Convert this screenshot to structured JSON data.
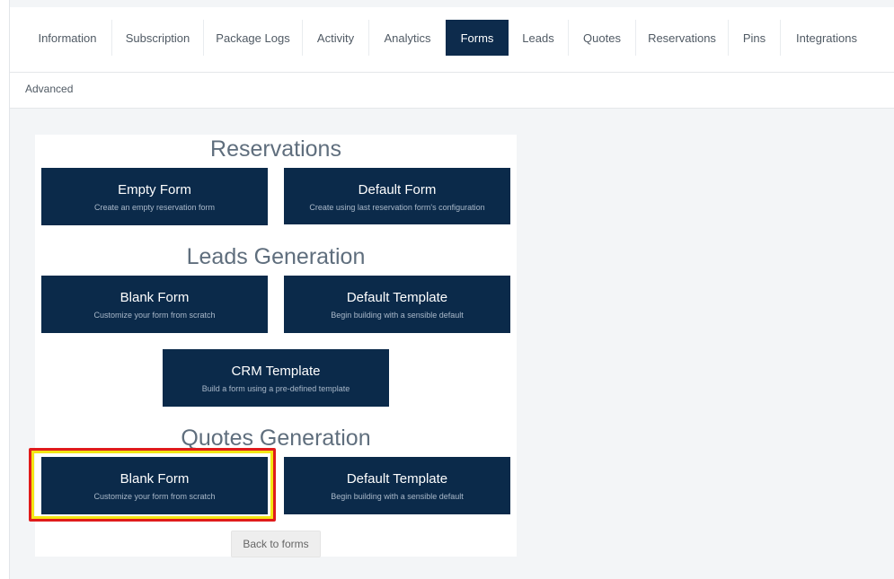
{
  "tabs": {
    "information": "Information",
    "subscription": "Subscription",
    "package_logs": "Package Logs",
    "activity": "Activity",
    "analytics": "Analytics",
    "forms": "Forms",
    "leads": "Leads",
    "quotes": "Quotes",
    "reservations": "Reservations",
    "pins": "Pins",
    "integrations": "Integrations",
    "active": "Forms"
  },
  "subnav": {
    "advanced": "Advanced"
  },
  "sections": {
    "reservations": {
      "title": "Reservations",
      "empty_form": {
        "title": "Empty Form",
        "subtitle": "Create an empty reservation form"
      },
      "default_form": {
        "title": "Default Form",
        "subtitle": "Create using last reservation form's configuration"
      }
    },
    "leads": {
      "title": "Leads Generation",
      "blank_form": {
        "title": "Blank Form",
        "subtitle": "Customize your form from scratch"
      },
      "default_template": {
        "title": "Default Template",
        "subtitle": "Begin building with a sensible default"
      },
      "crm_template": {
        "title": "CRM Template",
        "subtitle": "Build a form using a pre-defined template"
      }
    },
    "quotes": {
      "title": "Quotes Generation",
      "blank_form": {
        "title": "Blank Form",
        "subtitle": "Customize your form from scratch"
      },
      "default_template": {
        "title": "Default Template",
        "subtitle": "Begin building with a sensible default"
      }
    }
  },
  "back_button": "Back to forms",
  "colors": {
    "card_bg": "#0b2a4a",
    "active_tab_bg": "#0d2b4c",
    "highlight_outer": "#e01b1b",
    "highlight_inner": "#f3e614"
  }
}
